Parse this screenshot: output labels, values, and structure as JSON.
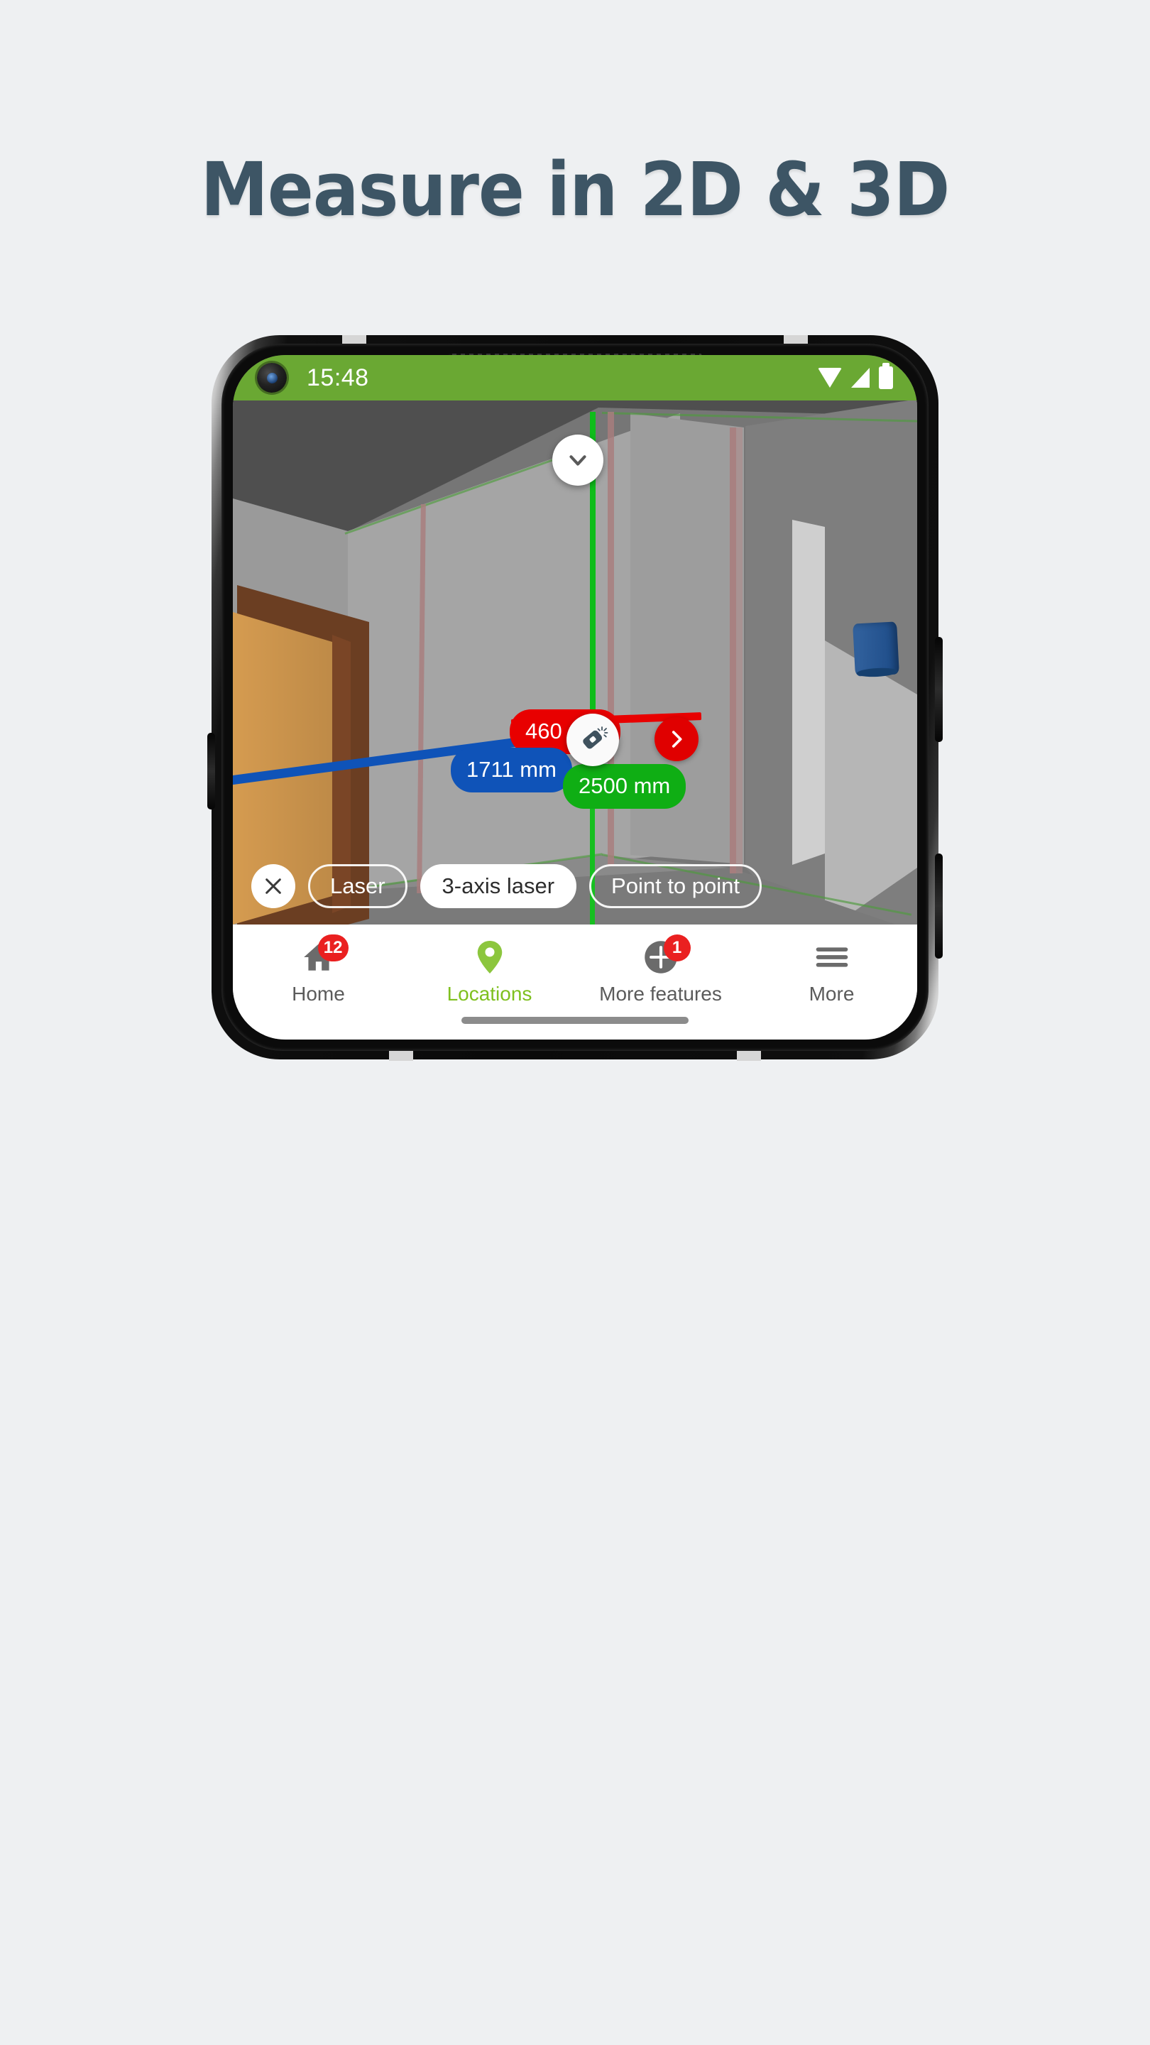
{
  "headline": "Measure in 2D & 3D",
  "status_bar": {
    "time": "15:48",
    "background": "#6aa833",
    "icons": [
      "wifi-icon",
      "cell-signal-icon",
      "battery-icon"
    ],
    "camera": "punch-hole-camera"
  },
  "ar_scene": {
    "mode": "3-axis laser",
    "measurements": [
      {
        "id": "red",
        "value": "460 mm",
        "color": "#e80000",
        "axis": "horizontal-depth"
      },
      {
        "id": "blue",
        "value": "1711 mm",
        "color": "#0f53b8",
        "axis": "horizontal-width"
      },
      {
        "id": "green",
        "value": "2500 mm",
        "color": "#0fae14",
        "axis": "vertical-height"
      }
    ],
    "center_handle": "laser-distance-meter-icon",
    "buttons": {
      "collapse_top": "chevron-down-icon",
      "collapse_bottom": "chevron-down-icon",
      "next": "chevron-right-icon"
    }
  },
  "chipbar": {
    "close_label": "×",
    "chips": [
      {
        "label": "Laser",
        "selected": false
      },
      {
        "label": "3-axis laser",
        "selected": true
      },
      {
        "label": "Point to point",
        "selected": false
      }
    ]
  },
  "bottom_nav": {
    "items": [
      {
        "label": "Home",
        "icon": "home-icon",
        "badge": "12",
        "active": false
      },
      {
        "label": "Locations",
        "icon": "map-pin-icon",
        "badge": "",
        "active": true
      },
      {
        "label": "More features",
        "icon": "plus-circle-icon",
        "badge": "1",
        "active": false
      },
      {
        "label": "More",
        "icon": "hamburger-menu-icon",
        "badge": "",
        "active": false
      }
    ]
  },
  "colors": {
    "accent_green": "#7fc01f",
    "status_green": "#6aa833",
    "badge_red": "#ea2020",
    "headline": "#3d5565",
    "page_bg": "#eef0f2"
  }
}
